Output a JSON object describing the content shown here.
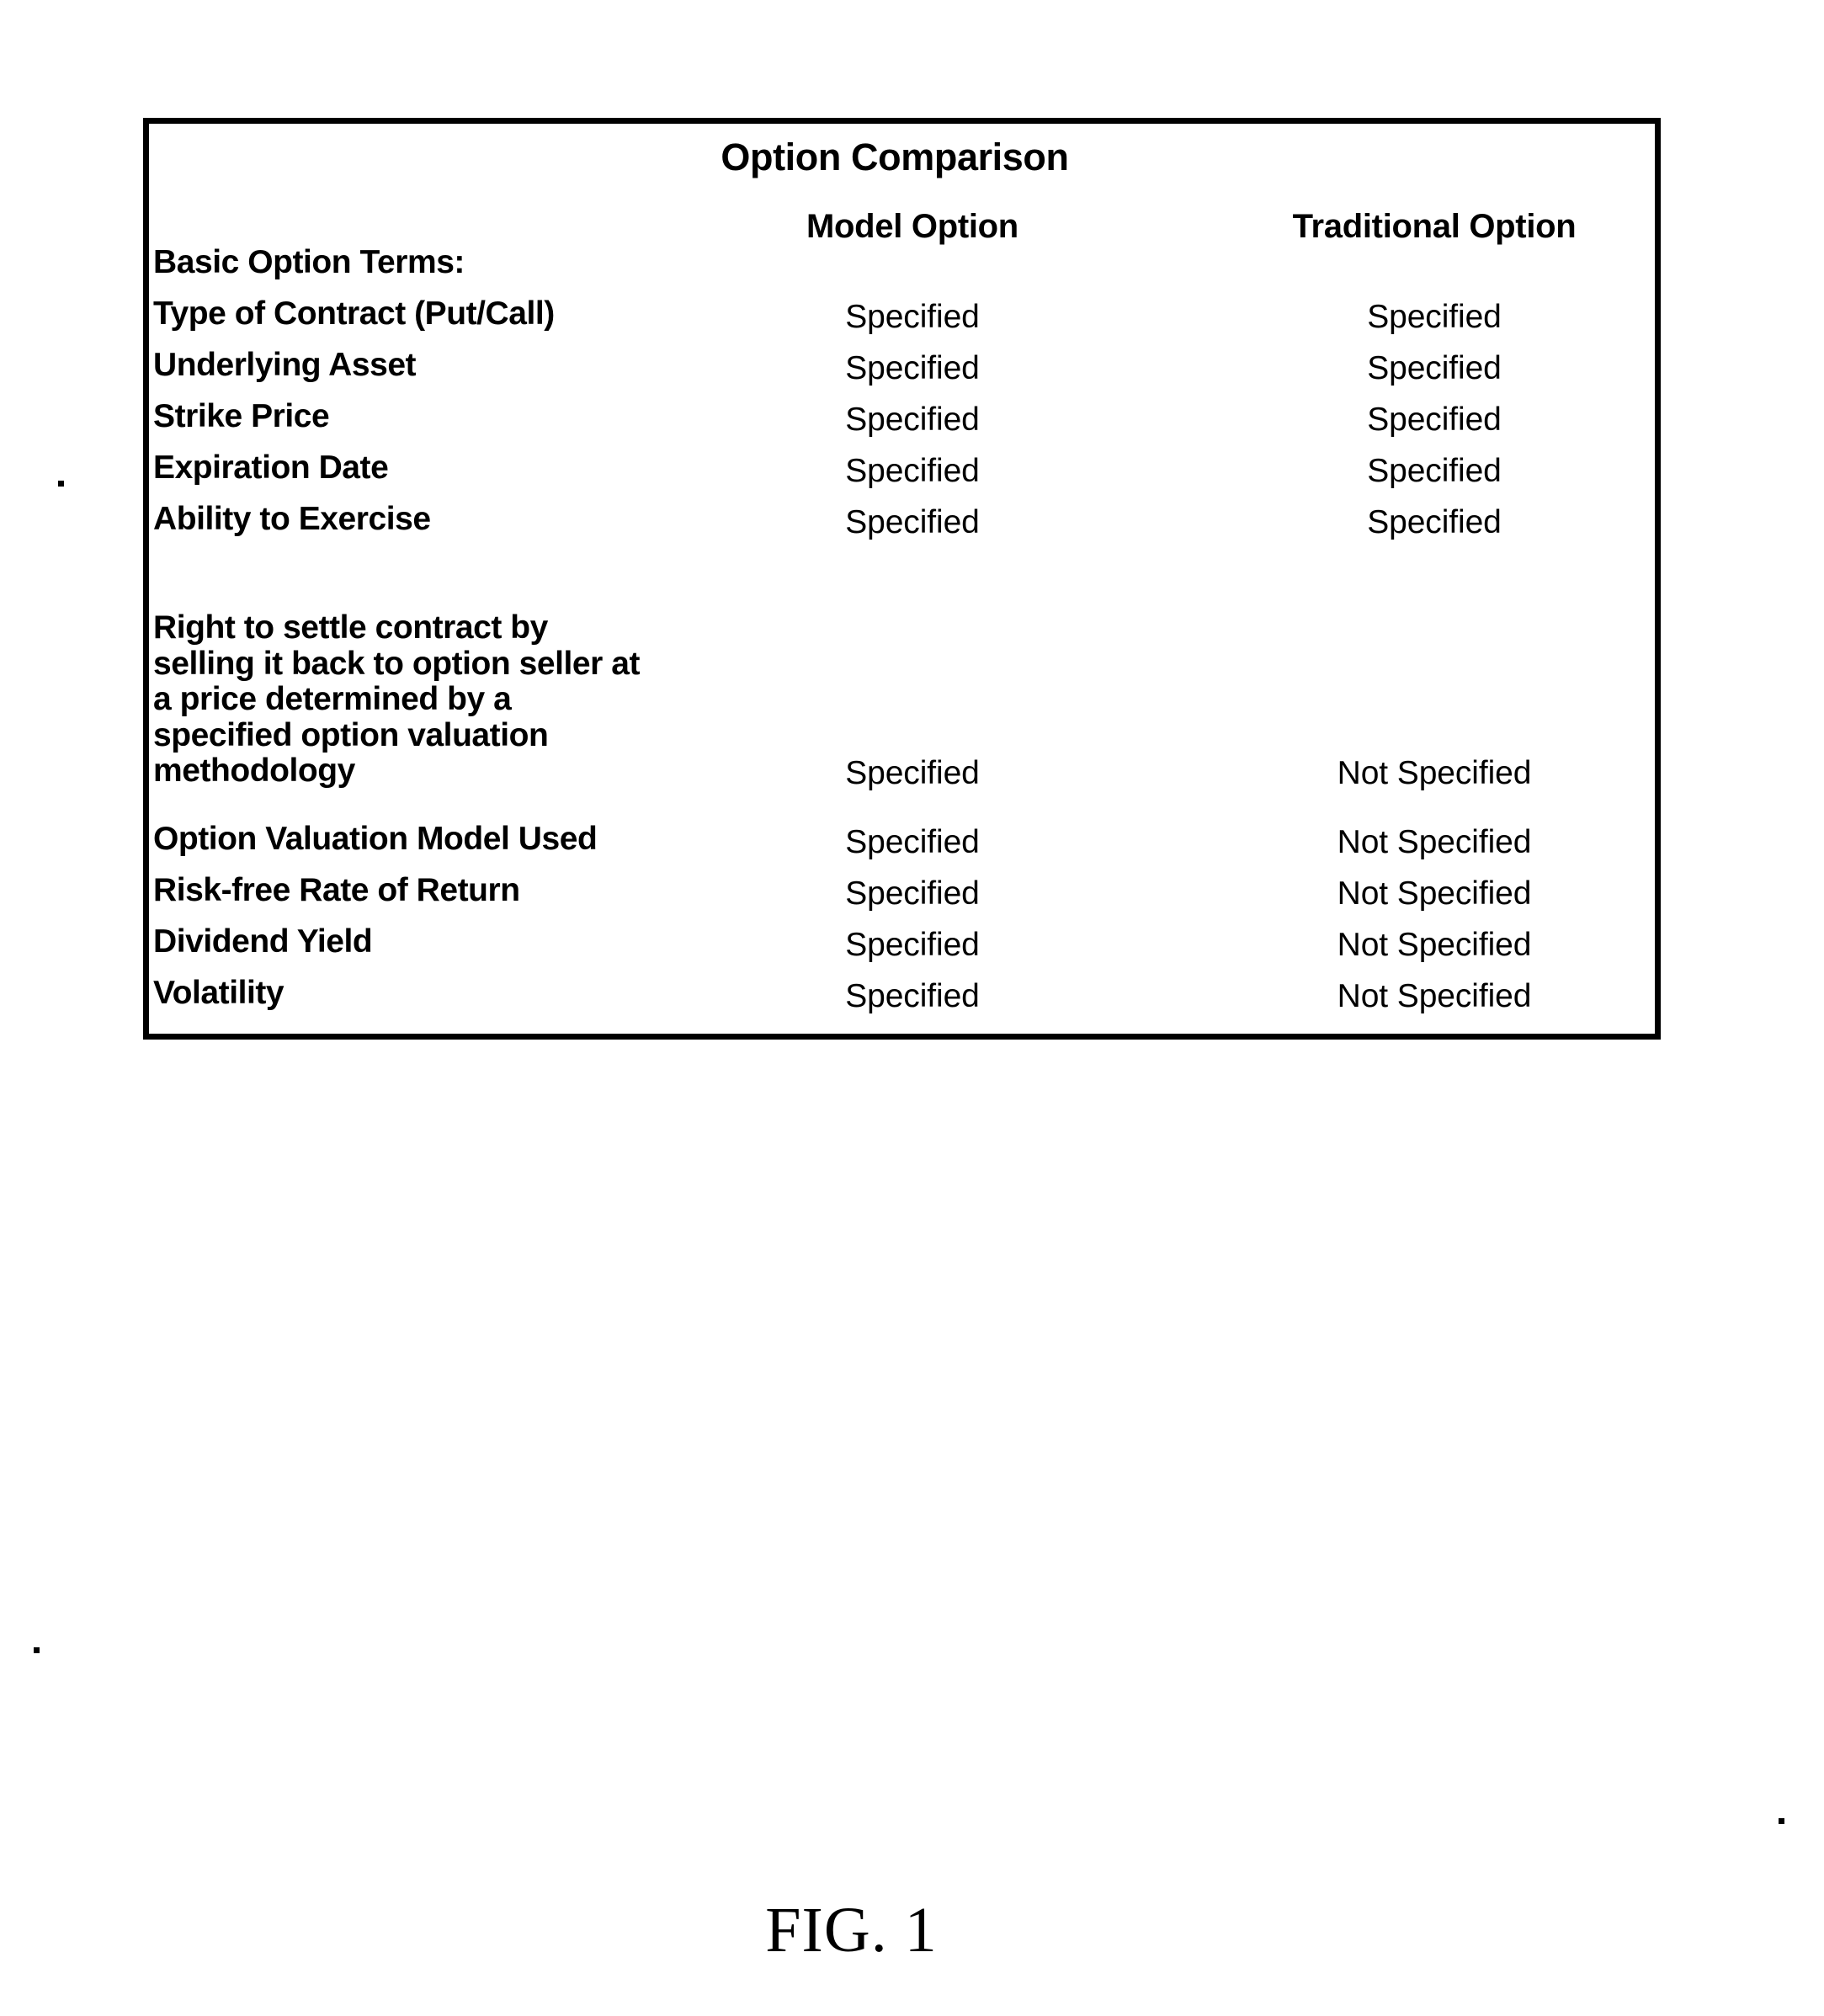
{
  "figure": {
    "caption": "FIG. 1"
  },
  "table": {
    "title": "Option Comparison",
    "columns": [
      {
        "key": "model",
        "label": "Model Option"
      },
      {
        "key": "traditional",
        "label": "Traditional Option"
      }
    ],
    "section_heading": "Basic Option Terms:",
    "rows": [
      {
        "label": "Type of Contract (Put/Call)",
        "model": "Specified",
        "traditional": "Specified"
      },
      {
        "label": "Underlying Asset",
        "model": "Specified",
        "traditional": "Specified"
      },
      {
        "label": "Strike Price",
        "model": "Specified",
        "traditional": "Specified"
      },
      {
        "label": "Expiration Date",
        "model": "Specified",
        "traditional": "Specified"
      },
      {
        "label": "Ability to Exercise",
        "model": "Specified",
        "traditional": "Specified"
      }
    ],
    "settlement_row": {
      "label_lines": [
        "Right to settle contract by",
        "selling it back to option seller at",
        "a price determined by a",
        "specified option valuation",
        "methodology"
      ],
      "model": "Specified",
      "traditional": "Not Specified"
    },
    "model_rows": [
      {
        "label": "Option Valuation Model Used",
        "model": "Specified",
        "traditional": "Not Specified"
      },
      {
        "label": "Risk-free Rate of Return",
        "model": "Specified",
        "traditional": "Not Specified"
      },
      {
        "label": "Dividend Yield",
        "model": "Specified",
        "traditional": "Not Specified"
      },
      {
        "label": "Volatility",
        "model": "Specified",
        "traditional": "Not Specified"
      }
    ]
  },
  "colors": {
    "ink": "#000000",
    "paper": "#ffffff"
  }
}
